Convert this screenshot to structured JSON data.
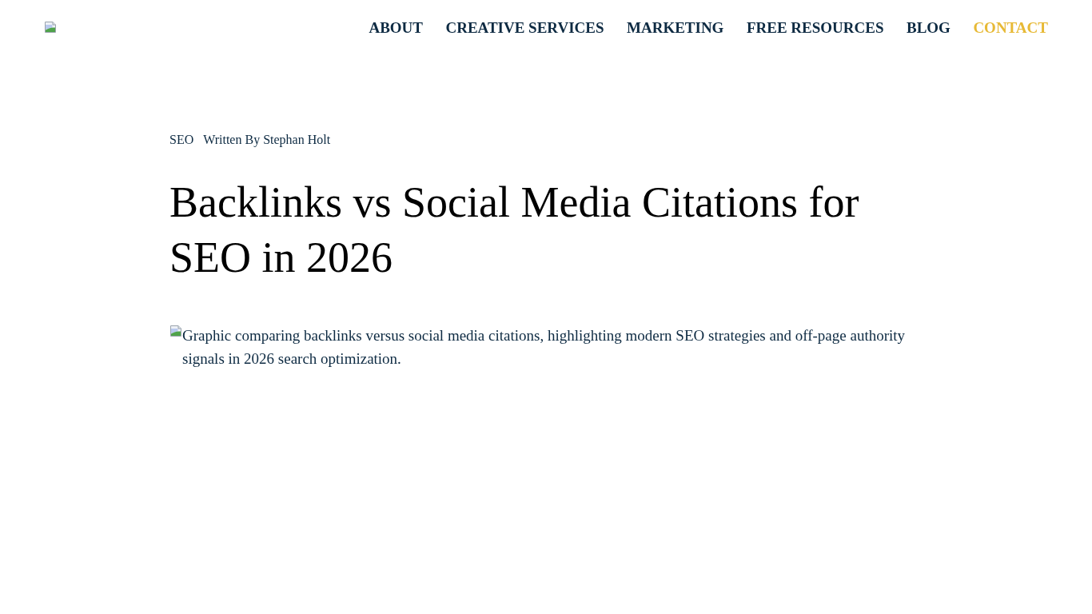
{
  "header": {
    "nav": [
      {
        "label": "ABOUT",
        "kind": "link"
      },
      {
        "label": "CREATIVE SERVICES",
        "kind": "link"
      },
      {
        "label": "MARKETING",
        "kind": "link"
      },
      {
        "label": "FREE RESOURCES",
        "kind": "link"
      },
      {
        "label": "BLOG",
        "kind": "link"
      },
      {
        "label": "CONTACT",
        "kind": "cta"
      }
    ]
  },
  "article": {
    "category": "SEO",
    "byline": "Written By Stephan Holt",
    "title": "Backlinks vs Social Media Citations for SEO in 2026",
    "image_alt": "Graphic comparing backlinks versus social media citations, highlighting modern SEO strategies and off-page authority signals in 2026 search optimization."
  }
}
